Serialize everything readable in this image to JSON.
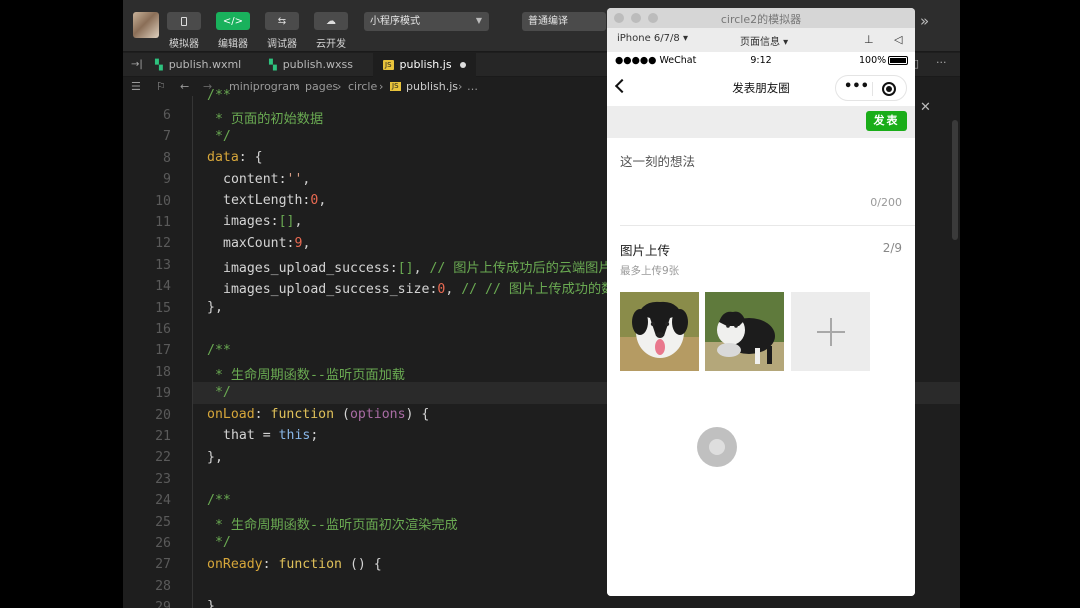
{
  "toolbar": {
    "buttons": [
      {
        "icon": "phone-icon",
        "label": "模拟器"
      },
      {
        "icon": "code-icon",
        "glyph": "</>",
        "label": "编辑器"
      },
      {
        "icon": "debug-icon",
        "glyph": "⇆",
        "label": "调试器"
      },
      {
        "icon": "cloud-icon",
        "glyph": "☁",
        "label": "云开发"
      }
    ],
    "mode_select": "小程序模式",
    "compile_select": "普通编译",
    "more": "»"
  },
  "tabs": [
    {
      "label": "publish.wxml",
      "active": false
    },
    {
      "label": "publish.wxss",
      "active": false
    },
    {
      "label": "publish.js",
      "active": true
    }
  ],
  "breadcrumb": {
    "items": [
      "miniprogram",
      "pages",
      "circle",
      "publish.js",
      "…"
    ],
    "separator": "›"
  },
  "code": {
    "line_numbers": [
      "6",
      "7",
      "8",
      "9",
      "10",
      "11",
      "12",
      "13",
      "14",
      "15",
      "16",
      "17",
      "18",
      "19",
      "20",
      "21",
      "22",
      "23",
      "24",
      "25",
      "26",
      "27",
      "28",
      "29"
    ],
    "comment_page_data": " * 页面的初始数据",
    "comment_end": " */",
    "comment_start": "/**",
    "data_key": "data",
    "content_key": "content",
    "text_length_key": "textLength",
    "images_key": "images",
    "max_count_key": "maxCount",
    "max_count_value": "9",
    "upload_success_key": "images_upload_success",
    "upload_success_comment": " // 图片上传成功后的云端图片",
    "upload_size_key": "images_upload_success_size",
    "upload_size_comment": " // // 图片上传成功的数",
    "comment_onload": " * 生命周期函数--监听页面加载",
    "onload_key": "onLoad",
    "function_kw": "function",
    "options_param": "options",
    "that_var": "that",
    "this_kw": "this",
    "comment_onready": " * 生命周期函数--监听页面初次渲染完成",
    "onready_key": "onReady"
  },
  "simulator": {
    "window_title": "circle2的模拟器",
    "device": "iPhone 6/7/8 ▾",
    "page_info": "页面信息 ▾",
    "status_bar": {
      "carrier": "●●●●● WeChat",
      "time": "9:12",
      "battery": "100%"
    },
    "nav_title": "发表朋友圈",
    "publish_button": "发表",
    "placeholder": "这一刻的想法",
    "char_counter": "0/200",
    "upload_title": "图片上传",
    "upload_count": "2/9",
    "upload_hint": "最多上传9张",
    "colors": {
      "publish_green": "#1aad19",
      "ide_active_green": "#19b15c"
    }
  }
}
